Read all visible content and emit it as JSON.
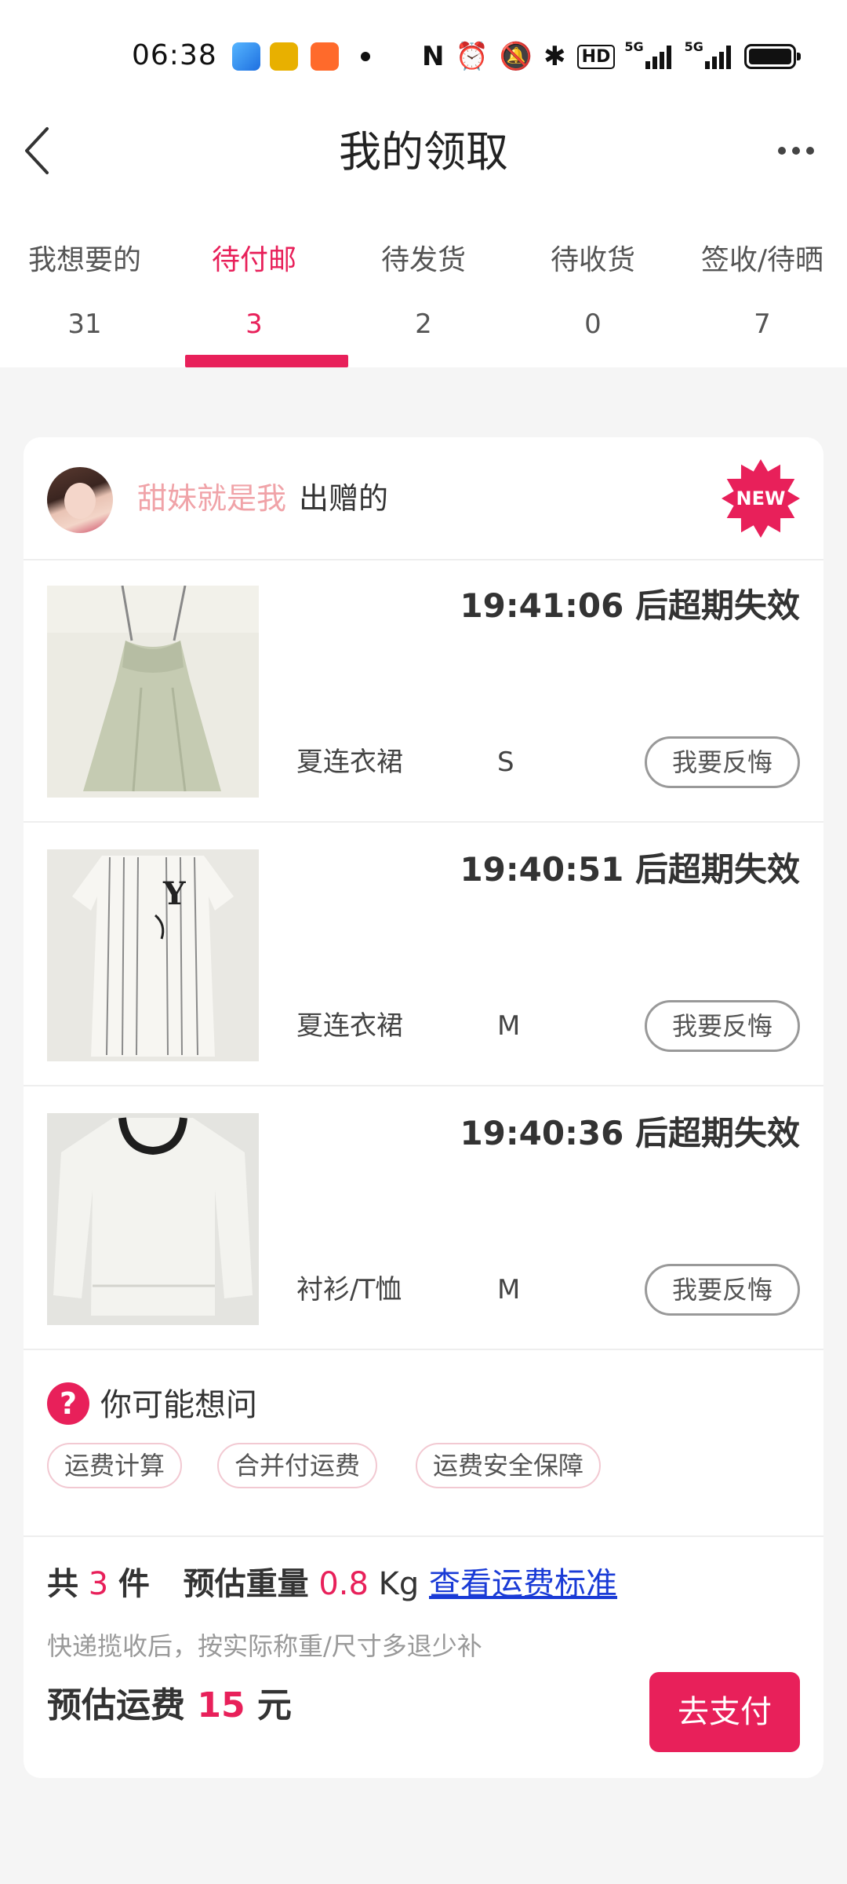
{
  "status_bar": {
    "time": "06:38",
    "network_labels": [
      "HD",
      "5G",
      "5G"
    ],
    "icons": [
      "messenger-app-icon",
      "pubg-app-icon",
      "app-store-icon",
      "nfc-icon",
      "alarm-icon",
      "mute-icon",
      "bluetooth-icon",
      "battery-icon"
    ]
  },
  "header": {
    "title": "我的领取"
  },
  "tabs": [
    {
      "label": "我想要的",
      "count": "31"
    },
    {
      "label": "待付邮",
      "count": "3"
    },
    {
      "label": "待发货",
      "count": "2"
    },
    {
      "label": "待收货",
      "count": "0"
    },
    {
      "label": "签收/待晒",
      "count": "7"
    }
  ],
  "active_tab_index": 1,
  "colors": {
    "accent": "#e8205a",
    "giver_name": "#f0a3a8",
    "link": "#1a3bd6",
    "background": "#f5f5f5"
  },
  "giver": {
    "name": "甜妹就是我",
    "suffix": "出赠的",
    "badge": "NEW"
  },
  "items": [
    {
      "timer": "19:41:06 后超期失效",
      "category": "夏连衣裙",
      "size": "S",
      "action": "我要反悔",
      "image": "sage-green-slip-dress"
    },
    {
      "timer": "19:40:51 后超期失效",
      "category": "夏连衣裙",
      "size": "M",
      "action": "我要反悔",
      "image": "white-pinstripe-shirt-dress"
    },
    {
      "timer": "19:40:36 后超期失效",
      "category": "衬衫/T恤",
      "size": "M",
      "action": "我要反悔",
      "image": "white-long-sleeve-top"
    }
  ],
  "faq": {
    "icon": "?",
    "title": "你可能想问",
    "chips": [
      "运费计算",
      "合并付运费",
      "运费安全保障"
    ]
  },
  "summary": {
    "count_prefix": "共",
    "count": "3",
    "count_unit": "件",
    "weight_label": "预估重量",
    "weight": "0.8",
    "weight_unit": "Kg",
    "link": "查看运费标准",
    "note": "快递揽收后，按实际称重/尺寸多退少补",
    "fee_label": "预估运费",
    "fee": "15",
    "fee_unit": "元",
    "pay_button": "去支付"
  }
}
